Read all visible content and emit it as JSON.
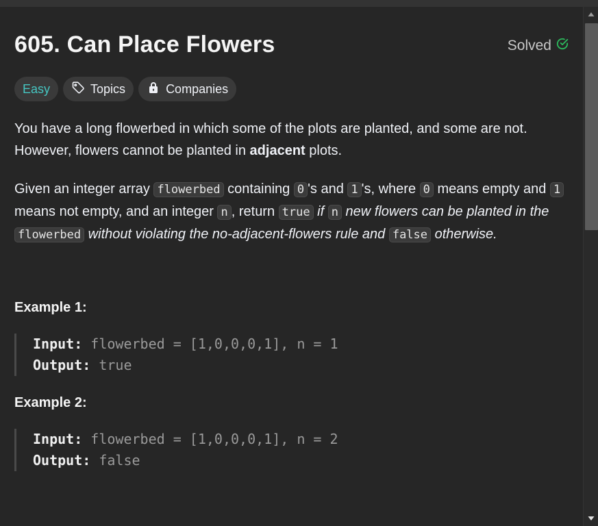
{
  "problem": {
    "title": "605. Can Place Flowers",
    "status": "Solved",
    "status_color": "#2cbb5d"
  },
  "tags": {
    "difficulty": "Easy",
    "topics": "Topics",
    "companies": "Companies"
  },
  "description": {
    "p1_part1": "You have a long flowerbed in which some of the plots are planted, and some are not. However, flowers cannot be planted in ",
    "p1_bold": "adjacent",
    "p1_part2": " plots.",
    "p2": {
      "t1": "Given an integer array ",
      "c1": "flowerbed",
      "t2": " containing ",
      "c2": "0",
      "t3": "'s and ",
      "c3": "1",
      "t4": "'s, where ",
      "c4": "0",
      "t5": " means empty and ",
      "c5": "1",
      "t6": " means not empty, and an integer ",
      "c6": "n",
      "t7": ", return ",
      "c7": "true",
      "i1": " if ",
      "c8": "n",
      "i2": " new flowers can be planted in the ",
      "c9": "flowerbed",
      "i3": " without violating the no-adjacent-flowers rule and ",
      "c10": "false",
      "i4": " otherwise."
    }
  },
  "examples": [
    {
      "title": "Example 1:",
      "input_label": "Input:",
      "input": " flowerbed = [1,0,0,0,1], n = 1",
      "output_label": "Output:",
      "output": " true"
    },
    {
      "title": "Example 2:",
      "input_label": "Input:",
      "input": " flowerbed = [1,0,0,0,1], n = 2",
      "output_label": "Output:",
      "output": " false"
    }
  ]
}
